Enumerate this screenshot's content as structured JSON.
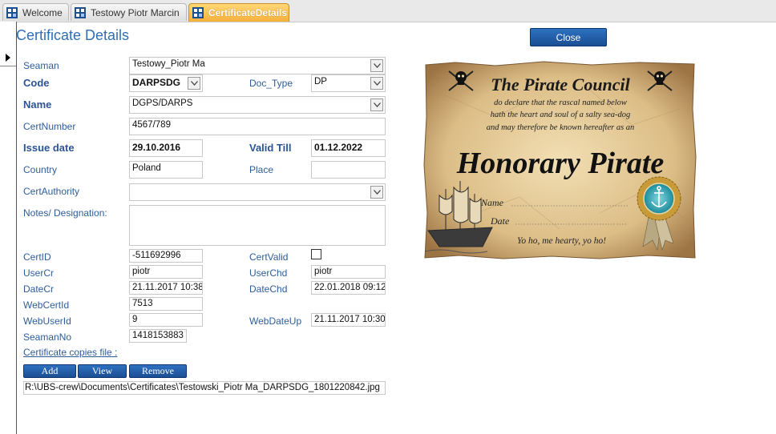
{
  "tabs": [
    {
      "label": "Welcome"
    },
    {
      "label": "Testowy Piotr Marcin"
    },
    {
      "label": "CertificateDetails"
    }
  ],
  "page": {
    "title": "Certificate Details",
    "close_label": "Close"
  },
  "form": {
    "seaman": {
      "label": "Seaman",
      "value": "Testowy_Piotr Ma"
    },
    "code": {
      "label": "Code",
      "value": "DARPSDG"
    },
    "doc_type": {
      "label": "Doc_Type",
      "value": "DP"
    },
    "name": {
      "label": "Name",
      "value": "DGPS/DARPS"
    },
    "cert_number": {
      "label": "CertNumber",
      "value": "4567/789"
    },
    "issue_date": {
      "label": "Issue date",
      "value": "29.10.2016"
    },
    "valid_till": {
      "label": "Valid Till",
      "value": "01.12.2022"
    },
    "country": {
      "label": "Country",
      "value": "Poland"
    },
    "place": {
      "label": "Place",
      "value": ""
    },
    "cert_authority": {
      "label": "CertAuthority",
      "value": ""
    },
    "notes": {
      "label": "Notes/ Designation:",
      "value": ""
    },
    "cert_id": {
      "label": "CertID",
      "value": "-511692996"
    },
    "cert_valid": {
      "label": "CertValid",
      "checked": false
    },
    "user_cr": {
      "label": "UserCr",
      "value": "piotr"
    },
    "user_chd": {
      "label": "UserChd",
      "value": "piotr"
    },
    "date_cr": {
      "label": "DateCr",
      "value": "21.11.2017 10:38:"
    },
    "date_chd": {
      "label": "DateChd",
      "value": "22.01.2018 09:12:"
    },
    "web_cert_id": {
      "label": "WebCertId",
      "value": "7513"
    },
    "web_user_id": {
      "label": "WebUserId",
      "value": "9"
    },
    "web_date_up": {
      "label": "WebDateUp",
      "value": "21.11.2017 10:30:"
    },
    "seaman_no": {
      "label": "SeamanNo",
      "value": "1418153883"
    }
  },
  "copies": {
    "link_label": "Certificate copies file :",
    "add_label": "Add",
    "view_label": "View",
    "remove_label": "Remove",
    "file_path": "R:\\UBS-crew\\Documents\\Certificates\\Testowski_Piotr Ma_DARPSDG_1801220842.jpg"
  },
  "certificate_image": {
    "heading": "The Pirate Council",
    "line1": "do declare that the rascal named below",
    "line2": "hath the heart and soul of a salty sea-dog",
    "line3": "and may therefore be known hereafter as an",
    "big_title": "Honorary Pirate",
    "name_label": "Name",
    "date_label": "Date",
    "motto": "Yo ho, me hearty, yo ho!"
  },
  "colors": {
    "accent": "#2e6fb3",
    "button": "#1f5ba6",
    "active_tab": "#f7b13a",
    "parchment": "#e3c99a"
  }
}
